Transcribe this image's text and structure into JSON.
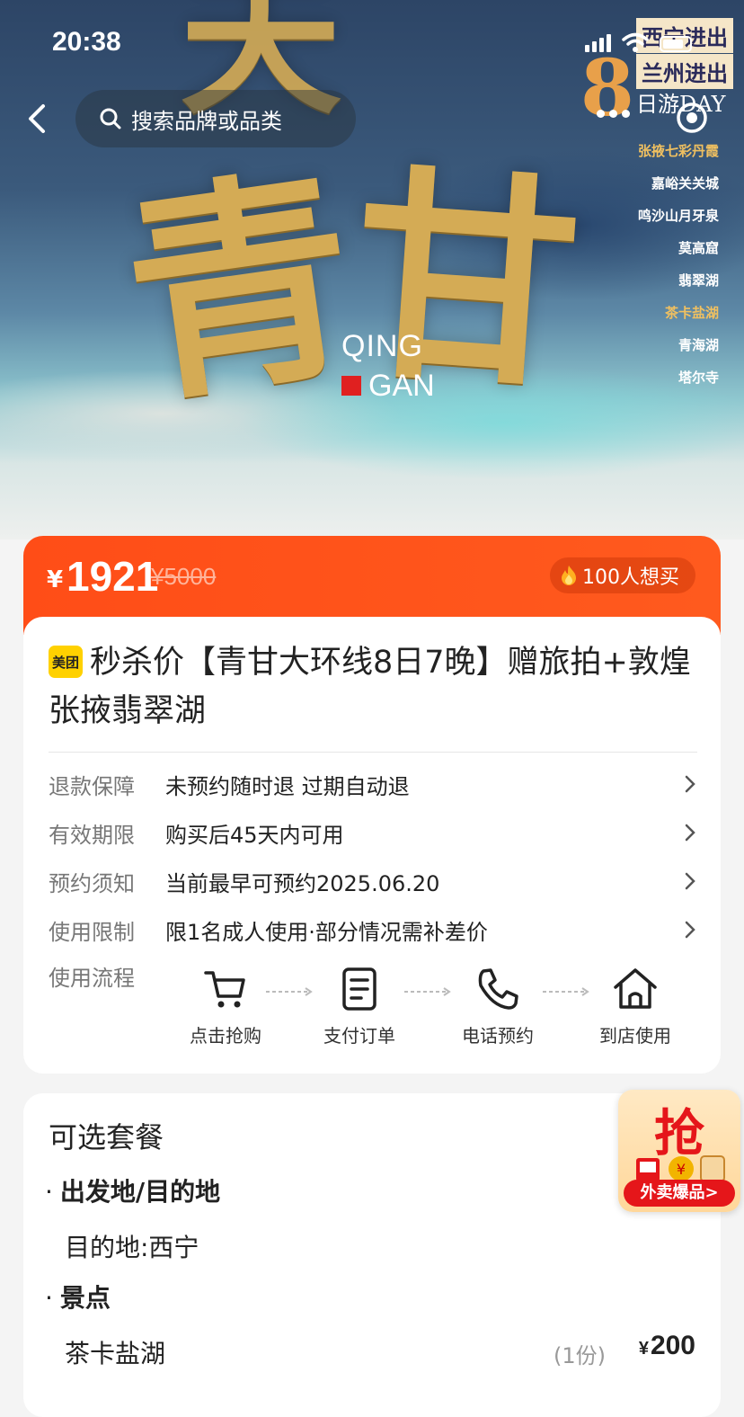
{
  "status_bar": {
    "time": "20:38"
  },
  "hero": {
    "chars": [
      "天",
      "青",
      "甘"
    ],
    "logo_en_1": "QING",
    "logo_en_2": "GAN",
    "badges": [
      "西宁进出",
      "兰州进出"
    ],
    "days_number": "8",
    "days_text": "日游DAY",
    "places": [
      "张掖七彩丹霞",
      "嘉峪关关城",
      "鸣沙山月牙泉",
      "莫高窟",
      "翡翠湖",
      "茶卡盐湖",
      "青海湖",
      "塔尔寺"
    ]
  },
  "search": {
    "placeholder": "搜索品牌或品类"
  },
  "price": {
    "currency": "¥",
    "current": "1921",
    "original": "¥5000",
    "want_count": "100人想买"
  },
  "product": {
    "logo_text": "美团",
    "title": "秒杀价【青甘大环线8日7晚】赠旅拍+敦煌张掖翡翠湖"
  },
  "info_rows": [
    {
      "key": "退款保障",
      "value": "未预约随时退 过期自动退"
    },
    {
      "key": "有效期限",
      "value": "购买后45天内可用"
    },
    {
      "key": "预约须知",
      "value": "当前最早可预约2025.06.20"
    },
    {
      "key": "使用限制",
      "value": "限1名成人使用·部分情况需补差价"
    }
  ],
  "flow": {
    "label": "使用流程",
    "steps": [
      "点击抢购",
      "支付订单",
      "电话预约",
      "到店使用"
    ]
  },
  "packages": {
    "title": "可选套餐",
    "section1": "出发地/目的地",
    "section1_value": "目的地:西宁",
    "section2": "景点",
    "item_name": "茶卡盐湖",
    "item_qty": "(1份)",
    "item_currency": "¥",
    "item_price": "200"
  },
  "float_ad": {
    "big": "抢",
    "button": "外卖爆品>"
  }
}
